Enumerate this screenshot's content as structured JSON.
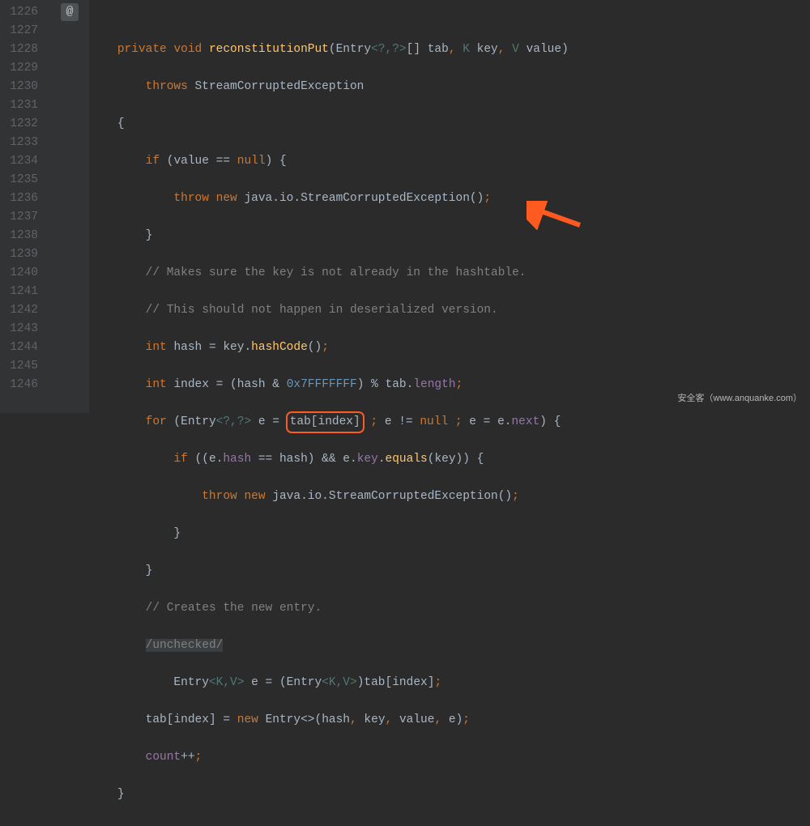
{
  "gutter": {
    "start": 1226,
    "end": 1246,
    "marker": "@"
  },
  "code": {
    "l0": {
      "indent": "    ",
      "kw_priv": "private",
      "sp": " ",
      "kw_void": "void",
      "fn": "reconstitutionPut",
      "open": "(",
      "typ_entry": "Entry",
      "gen": "<?,?>",
      "arr": "[] ",
      "par_tab": "tab",
      "c1": ", ",
      "gen_k": "K ",
      "par_key": "key",
      "c2": ", ",
      "gen_v": "V ",
      "par_val": "value",
      "close": ")"
    },
    "l1": {
      "indent": "        ",
      "kw": "throws",
      "sp": " ",
      "typ": "StreamCorruptedException"
    },
    "l2": {
      "indent": "    ",
      "brace": "{"
    },
    "l3": {
      "indent": "        ",
      "kw": "if",
      "open": " (",
      "par": "value",
      "op": " == ",
      "nul": "null",
      "close": ") {"
    },
    "l4": {
      "indent": "            ",
      "kw_throw": "throw",
      "sp": " ",
      "kw_new": "new",
      "sp2": " ",
      "pkg": "java.io.",
      "typ": "StreamCorruptedException",
      "call": "()",
      "semi": ";"
    },
    "l5": {
      "indent": "        ",
      "brace": "}"
    },
    "l6": {
      "indent": "        ",
      "cmt": "// Makes sure the key is not already in the hashtable."
    },
    "l7": {
      "indent": "        ",
      "cmt": "// This should not happen in deserialized version."
    },
    "l8": {
      "indent": "        ",
      "kw": "int",
      "sp": " ",
      "var": "hash",
      "eq": " = ",
      "par": "key",
      "dot": ".",
      "fn": "hashCode",
      "call": "()",
      "semi": ";"
    },
    "l9": {
      "indent": "        ",
      "kw": "int",
      "sp": " ",
      "var": "index",
      "eq": " = (",
      "var2": "hash",
      "amp": " & ",
      "hex": "0x7FFFFFFF",
      "close": ") % ",
      "par": "tab",
      "dot": ".",
      "fld": "length",
      "semi": ";"
    },
    "l10": {
      "indent": "        ",
      "kw": "for",
      "open": " (",
      "typ": "Entry",
      "gen": "<?,?>",
      "sp": " ",
      "var_e": "e",
      "eq": " = ",
      "hl_tab": "tab",
      "hl_open": "[",
      "hl_idx": "index",
      "hl_close": "]",
      "sc1": " ; ",
      "e2": "e",
      "neq": " != ",
      "nul": "null",
      "sc2": " ; ",
      "e3": "e",
      "eq2": " = ",
      "e4": "e",
      "dot": ".",
      "fld": "next",
      "close": ") {"
    },
    "l11": {
      "indent": "            ",
      "kw": "if",
      "open": " ((",
      "e": "e",
      "dot": ".",
      "fld_hash": "hash",
      "eqeq": " == ",
      "var": "hash",
      "mid": ") && ",
      "e2": "e",
      "dot2": ".",
      "fld_key": "key",
      "dot3": ".",
      "fn": "equals",
      "open2": "(",
      "par": "key",
      "close": ")) {"
    },
    "l12": {
      "indent": "                ",
      "kw_throw": "throw",
      "sp": " ",
      "kw_new": "new",
      "sp2": " ",
      "pkg": "java.io.",
      "typ": "StreamCorruptedException",
      "call": "()",
      "semi": ";"
    },
    "l13": {
      "indent": "            ",
      "brace": "}"
    },
    "l14": {
      "indent": "        ",
      "brace": "}"
    },
    "l15": {
      "indent": "        ",
      "cmt": "// Creates the new entry."
    },
    "l16": {
      "indent": "        ",
      "unc": "/unchecked/"
    },
    "l17": {
      "indent": "            ",
      "typ": "Entry",
      "gen": "<K,V>",
      "sp": " ",
      "var": "e",
      "eq": " = (",
      "typ2": "Entry",
      "gen2": "<K,V>",
      "close": ")",
      "par": "tab",
      "open": "[",
      "idx": "index",
      "close2": "]",
      "semi": ";"
    },
    "l18": {
      "indent": "        ",
      "par": "tab",
      "open": "[",
      "idx": "index",
      "close": "] = ",
      "kw": "new",
      "sp": " ",
      "typ": "Entry",
      "diam": "<>",
      "open2": "(",
      "a1": "hash",
      "c1": ", ",
      "a2": "key",
      "c2": ", ",
      "a3": "value",
      "c3": ", ",
      "a4": "e",
      "close2": ")",
      "semi": ";"
    },
    "l19": {
      "indent": "        ",
      "fld": "count",
      "op": "++",
      "semi": ";"
    },
    "l20": {
      "indent": "    ",
      "brace": "}"
    }
  },
  "watermark": "安全客（www.anquanke.com）"
}
